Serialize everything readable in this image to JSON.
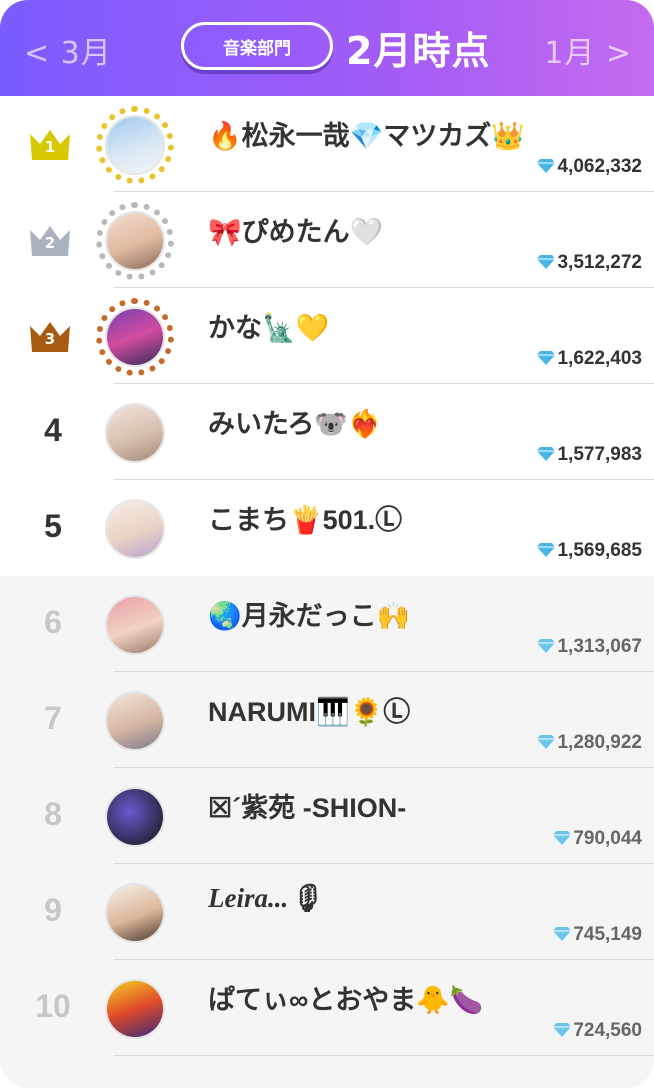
{
  "header": {
    "prev_label": "< 3月",
    "next_label": "1月 >",
    "category_label": "音楽部門",
    "period_label": "2月時点"
  },
  "colors": {
    "header_gradient_start": "#7b5cff",
    "header_gradient_end": "#c46bf0",
    "gold": "#d7c900",
    "silver": "#aab1bf",
    "bronze": "#a85a12",
    "diamond": "#4ab6e8"
  },
  "ranking": [
    {
      "rank": "1",
      "name": "🔥松永一哉💎マツカズ👑",
      "score": "4,062,332",
      "medal": "gold"
    },
    {
      "rank": "2",
      "name": "🎀ぴめたん🤍",
      "score": "3,512,272",
      "medal": "silver"
    },
    {
      "rank": "3",
      "name": "かな🗽💛",
      "score": "1,622,403",
      "medal": "bronze"
    },
    {
      "rank": "4",
      "name": "みいたろ🐨❤️‍🔥",
      "score": "1,577,983",
      "medal": ""
    },
    {
      "rank": "5",
      "name": "こまち🍟501.Ⓛ",
      "score": "1,569,685",
      "medal": ""
    },
    {
      "rank": "6",
      "name": "🌏月永だっこ🙌",
      "score": "1,313,067",
      "medal": ""
    },
    {
      "rank": "7",
      "name": "NARUMI🎹🌻Ⓛ",
      "score": "1,280,922",
      "medal": ""
    },
    {
      "rank": "8",
      "name": "☒´紫苑  -SHION-",
      "score": "790,044",
      "medal": ""
    },
    {
      "rank": "9",
      "name": "Leira...🎙",
      "score": "745,149",
      "medal": ""
    },
    {
      "rank": "10",
      "name": "ぱてぃ∞とおやま🐥🍆",
      "score": "724,560",
      "medal": ""
    }
  ]
}
